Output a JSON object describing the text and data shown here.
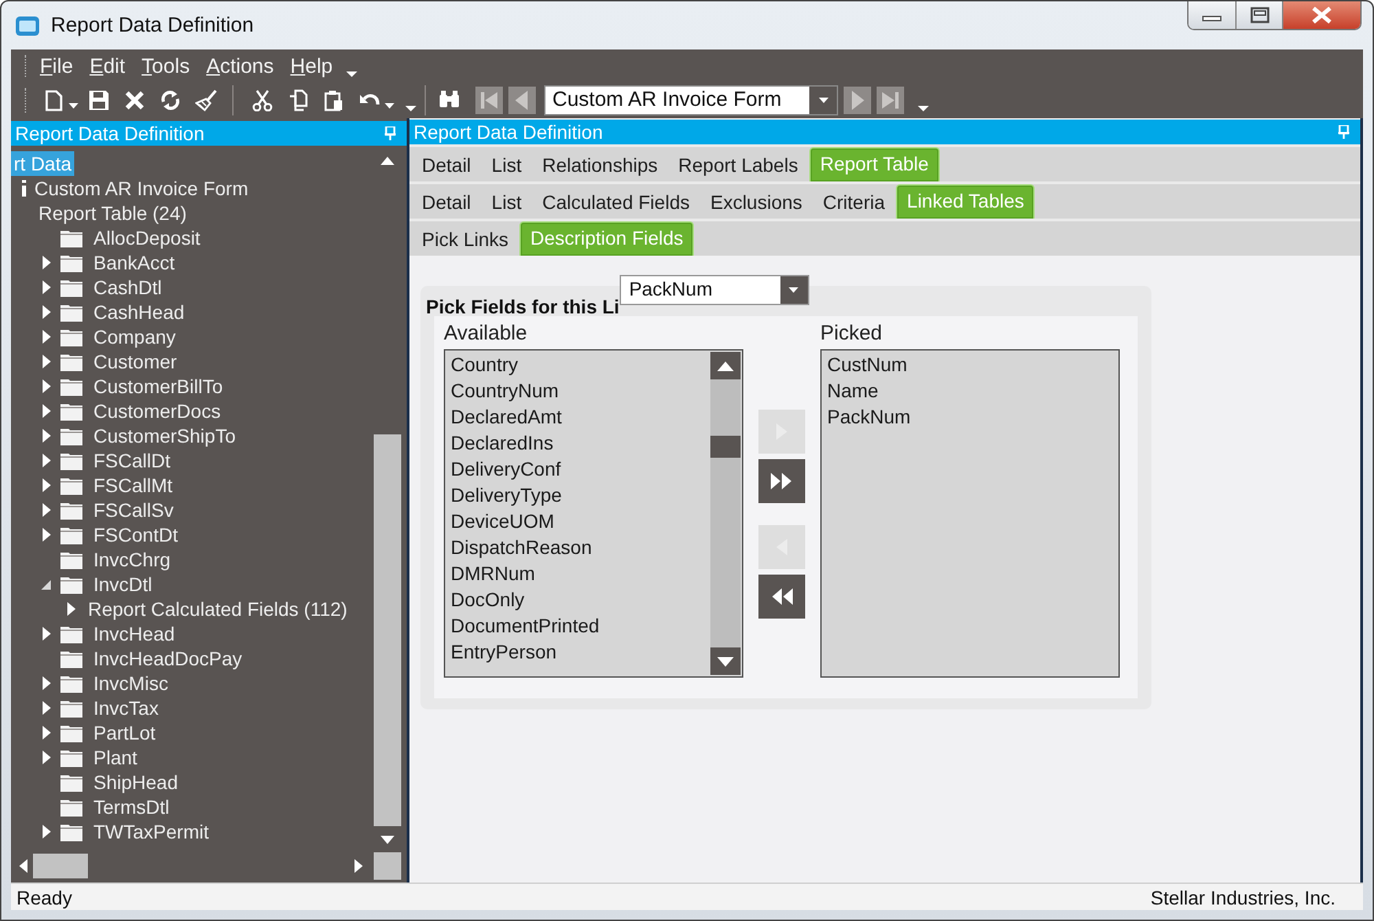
{
  "window": {
    "title": "Report Data Definition"
  },
  "menu": [
    "File",
    "Edit",
    "Tools",
    "Actions",
    "Help"
  ],
  "toolbar": {
    "groups": [
      [
        {
          "kind": "new",
          "dropdown": true
        },
        {
          "kind": "save",
          "dropdown": false
        },
        {
          "kind": "delete",
          "dropdown": false
        },
        {
          "kind": "refresh",
          "dropdown": false
        },
        {
          "kind": "clear",
          "dropdown": false
        }
      ],
      [
        {
          "kind": "cut",
          "dropdown": false
        },
        {
          "kind": "copy",
          "dropdown": false
        },
        {
          "kind": "paste",
          "dropdown": false
        },
        {
          "kind": "undo",
          "dropdown": true
        }
      ]
    ],
    "navigation": {
      "before": [
        {
          "kind": "find",
          "disabled": false
        },
        {
          "kind": "first",
          "disabled": true
        },
        {
          "kind": "previous",
          "disabled": true
        }
      ],
      "record": {
        "value": "Custom AR Invoice Form"
      },
      "after": [
        {
          "kind": "next",
          "disabled": true
        },
        {
          "kind": "last",
          "disabled": true
        }
      ]
    }
  },
  "tree_panel": {
    "title": "Report Data Definition",
    "tree": [
      {
        "label": "rt Data",
        "selected": true,
        "children": [
          {
            "label": "Custom AR Invoice Form",
            "kind": "item",
            "selected": false
          },
          {
            "label": "Report Table (24)",
            "selected": false,
            "children": [
              {
                "label": "AllocDeposit",
                "kind": "folder",
                "selected": false
              },
              {
                "label": "BankAcct",
                "kind": "folder",
                "selected": false,
                "expanded": false
              },
              {
                "label": "CashDtl",
                "kind": "folder",
                "selected": false,
                "expanded": false
              },
              {
                "label": "CashHead",
                "kind": "folder",
                "selected": false,
                "expanded": false
              },
              {
                "label": "Company",
                "kind": "folder",
                "selected": false,
                "expanded": false
              },
              {
                "label": "Customer",
                "kind": "folder",
                "selected": false,
                "expanded": false
              },
              {
                "label": "CustomerBillTo",
                "kind": "folder",
                "selected": false,
                "expanded": false
              },
              {
                "label": "CustomerDocs",
                "kind": "folder",
                "selected": false,
                "expanded": false
              },
              {
                "label": "CustomerShipTo",
                "kind": "folder",
                "selected": false,
                "expanded": false
              },
              {
                "label": "FSCallDt",
                "kind": "folder",
                "selected": false,
                "expanded": false
              },
              {
                "label": "FSCallMt",
                "kind": "folder",
                "selected": false,
                "expanded": false
              },
              {
                "label": "FSCallSv",
                "kind": "folder",
                "selected": false,
                "expanded": false
              },
              {
                "label": "FSContDt",
                "kind": "folder",
                "selected": false,
                "expanded": false
              },
              {
                "label": "InvcChrg",
                "kind": "folder",
                "selected": false
              },
              {
                "label": "InvcDtl",
                "kind": "folder",
                "selected": false,
                "expanded": true,
                "children": [
                  {
                    "label": "Report Calculated Fields (112)",
                    "selected": false,
                    "expanded": false
                  }
                ]
              },
              {
                "label": "InvcHead",
                "kind": "folder",
                "selected": false,
                "expanded": false
              },
              {
                "label": "InvcHeadDocPay",
                "kind": "folder",
                "selected": false
              },
              {
                "label": "InvcMisc",
                "kind": "folder",
                "selected": false,
                "expanded": false
              },
              {
                "label": "InvcTax",
                "kind": "folder",
                "selected": false,
                "expanded": false
              },
              {
                "label": "PartLot",
                "kind": "folder",
                "selected": false,
                "expanded": false
              },
              {
                "label": "Plant",
                "kind": "folder",
                "selected": false,
                "expanded": false
              },
              {
                "label": "ShipHead",
                "kind": "folder",
                "selected": false
              },
              {
                "label": "TermsDtl",
                "kind": "folder",
                "selected": false
              },
              {
                "label": "TWTaxPermit",
                "kind": "folder",
                "selected": false,
                "expanded": false
              }
            ]
          }
        ]
      }
    ]
  },
  "detail_panel": {
    "title": "Report Data Definition",
    "tab_rows": [
      [
        {
          "label": "Detail",
          "selected": false
        },
        {
          "label": "List",
          "selected": false
        },
        {
          "label": "Relationships",
          "selected": false
        },
        {
          "label": "Report Labels",
          "selected": false
        },
        {
          "label": "Report Table",
          "selected": true
        }
      ],
      [
        {
          "label": "Detail",
          "selected": false
        },
        {
          "label": "List",
          "selected": false
        },
        {
          "label": "Calculated Fields",
          "selected": false
        },
        {
          "label": "Exclusions",
          "selected": false
        },
        {
          "label": "Criteria",
          "selected": false
        },
        {
          "label": "Linked Tables",
          "selected": true
        }
      ],
      [
        {
          "label": "Pick Links",
          "selected": false
        },
        {
          "label": "Description Fields",
          "selected": true
        }
      ]
    ],
    "pick_fields": {
      "label": "Pick Fields for this Li",
      "link_table": {
        "value": "PackNum"
      },
      "available": {
        "label": "Available",
        "items": [
          "Country",
          "CountryNum",
          "DeclaredAmt",
          "DeclaredIns",
          "DeliveryConf",
          "DeliveryType",
          "DeviceUOM",
          "DispatchReason",
          "DMRNum",
          "DocOnly",
          "DocumentPrinted",
          "EntryPerson"
        ]
      },
      "buttons": [
        {
          "kind": "add",
          "disabled": true
        },
        {
          "kind": "add_all",
          "disabled": false
        },
        {
          "kind": "remove",
          "disabled": true
        },
        {
          "kind": "remove_all",
          "disabled": false
        }
      ],
      "picked": {
        "label": "Picked",
        "items": [
          "CustNum",
          "Name",
          "PackNum"
        ]
      }
    }
  },
  "status_bar": {
    "text": "Ready",
    "company": "Stellar Industries, Inc."
  }
}
